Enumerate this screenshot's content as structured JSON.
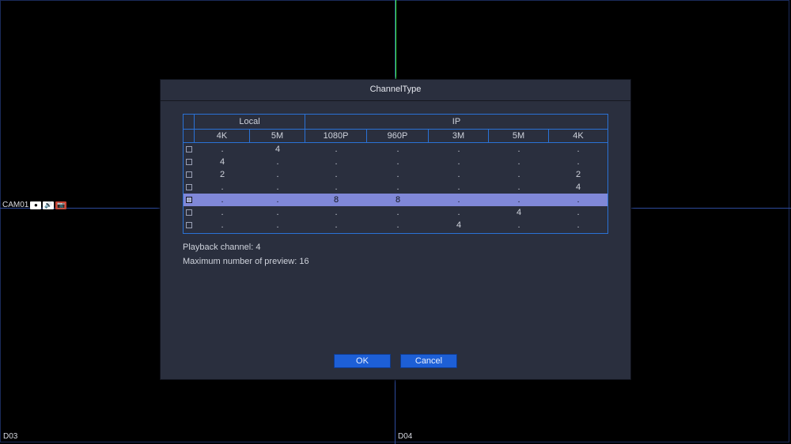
{
  "background": {
    "cam_label": "CAM01",
    "d03": "D03",
    "d04": "D04"
  },
  "dialog": {
    "title": "ChannelType",
    "groups": {
      "local": "Local",
      "ip": "IP"
    },
    "columns": [
      "4K",
      "5M",
      "1080P",
      "960P",
      "3M",
      "5M",
      "4K"
    ],
    "rows": [
      {
        "checked": false,
        "selected": false,
        "cells": [
          ".",
          "4",
          ".",
          ".",
          ".",
          ".",
          "."
        ]
      },
      {
        "checked": false,
        "selected": false,
        "cells": [
          "4",
          ".",
          ".",
          ".",
          ".",
          ".",
          "."
        ]
      },
      {
        "checked": false,
        "selected": false,
        "cells": [
          "2",
          ".",
          ".",
          ".",
          ".",
          ".",
          "2"
        ]
      },
      {
        "checked": false,
        "selected": false,
        "cells": [
          ".",
          ".",
          ".",
          ".",
          ".",
          ".",
          "4"
        ]
      },
      {
        "checked": true,
        "selected": true,
        "cells": [
          ".",
          ".",
          "8",
          "8",
          ".",
          ".",
          "."
        ]
      },
      {
        "checked": false,
        "selected": false,
        "cells": [
          ".",
          ".",
          ".",
          ".",
          ".",
          "4",
          "."
        ]
      },
      {
        "checked": false,
        "selected": false,
        "cells": [
          ".",
          ".",
          ".",
          ".",
          "4",
          ".",
          "."
        ]
      }
    ],
    "info": {
      "playback": "Playback channel: 4",
      "max_preview": "Maximum number of preview: 16"
    },
    "buttons": {
      "ok": "OK",
      "cancel": "Cancel"
    }
  }
}
